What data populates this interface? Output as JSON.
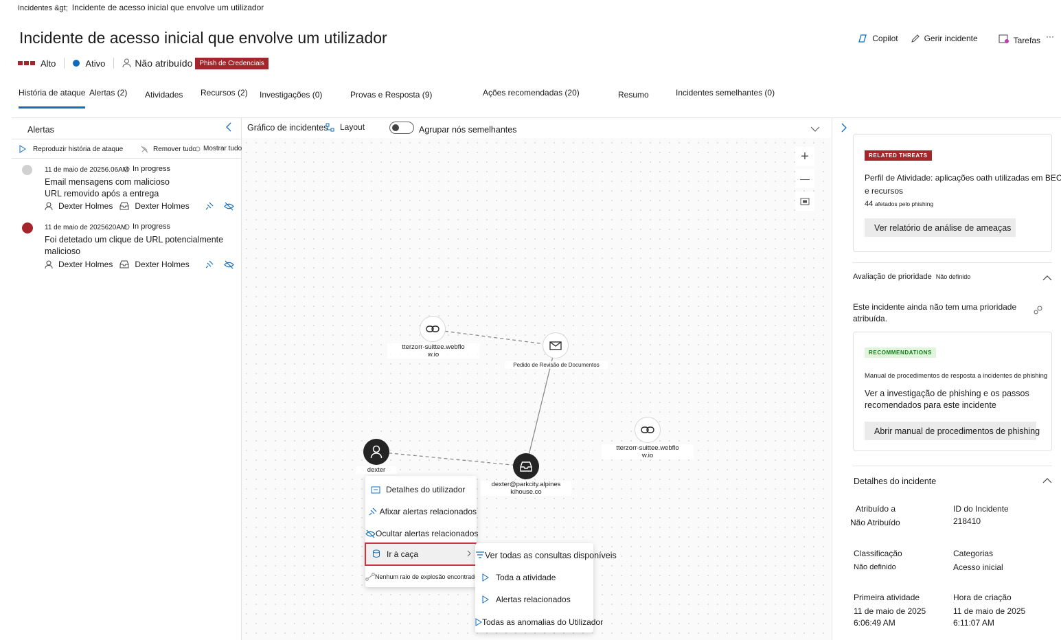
{
  "breadcrumb": {
    "root": "Incidentes &gt;",
    "current": "Incidente de acesso inicial que envolve um utilizador"
  },
  "page": {
    "title": "Incidente de acesso inicial que envolve um utilizador",
    "severity": "Alto",
    "status": "Ativo",
    "assignee": "Não atribuído",
    "tag": "Phish de Credenciais",
    "colors": {
      "severity": "#a4262c",
      "status": "#0f6cbd",
      "accent": "#0f6cbd"
    }
  },
  "actions": {
    "copilot": "Copilot",
    "manage": "Gerir incidente",
    "tasks": "Tarefas",
    "more": "···"
  },
  "tabs": [
    "História de ataque",
    "Alertas (2)",
    "Atividades",
    "Recursos (2)",
    "Investigações (0)",
    "Provas e Resposta (9)",
    "Ações recomendadas (20)",
    "Resumo",
    "Incidentes semelhantes (0)"
  ],
  "left_panel": {
    "title": "Alertas",
    "replay": "Reproduzir história de ataque",
    "remove_all": "Remover tudo",
    "show_all": "Mostrar tudo",
    "alerts": [
      {
        "date": "11 de maio de 20256.06AM",
        "status": "In progress",
        "title_line1": "Email mensagens com malicioso",
        "title_line2": "URL removido após a entrega",
        "user": "Dexter Holmes",
        "mailbox": "Dexter Holmes",
        "dot_color": "#d1d1d1"
      },
      {
        "date": "11 de maio de 2025620AM",
        "status": "In progress",
        "title_line1": "Foi detetado um clique de URL potencialmente",
        "title_line2": "malicioso",
        "user": "Dexter Holmes",
        "mailbox": "Dexter Holmes",
        "dot_color": "#a4262c"
      }
    ]
  },
  "graph": {
    "title": "Gráfico de incidentes",
    "layout": "Layout",
    "group_toggle": "Agrupar nós semelhantes",
    "zoom_in": "+",
    "zoom_out": "—",
    "nodes": {
      "url1_line1": "tterzorr-suittee.webflo",
      "url1_line2": "w.io",
      "email": "Pedido de Revisão de Documentos",
      "url2_line1": "tterzorr-suittee.webflo",
      "url2_line2": "w.io",
      "user": "dexter",
      "mailbox_line1": "dexter@parkcity.alpines",
      "mailbox_line2": "kihouse.co"
    },
    "context_menu": {
      "user_details": "Detalhes do utilizador",
      "pin_alerts": "Afixar alertas relacionados",
      "hide_alerts": "Ocultar alertas relacionados",
      "go_hunt": "Ir à caça",
      "blast_radius": "Nenhum raio de explosão encontrado"
    },
    "submenu": {
      "all_queries": "Ver todas as consultas disponíveis",
      "all_activity": "Toda a atividade",
      "related_alerts": "Alertas relacionados",
      "user_anomalies": "Todas as anomalias do Utilizador"
    }
  },
  "right_panel": {
    "threat_badge": "RELATED THREATS",
    "threat_title_line1": "Perfil de Atividade: aplicações oath utilizadas em BEC",
    "threat_title_line2": "e recursos",
    "threat_count": "44",
    "threat_count_label": "afetados pelo phishing",
    "threat_button": "Ver relatório de análise de ameaças",
    "priority_title": "Avaliação de prioridade",
    "priority_value": "Não definido",
    "priority_text_line1": "Este incidente ainda não tem uma prioridade",
    "priority_text_line2": "atribuída.",
    "rec_badge": "RECOMMENDATIONS",
    "rec_subtitle": "Manual de procedimentos de resposta a incidentes de phishing",
    "rec_text_line1": "Ver a investigação de phishing e os passos",
    "rec_text_line2": "recomendados para este incidente",
    "rec_button": "Abrir manual de procedimentos de phishing",
    "details_title": "Detalhes do incidente",
    "fields": {
      "assigned_label": "Atribuído a",
      "assigned_value": "Não Atribuído",
      "id_label": "ID do Incidente",
      "id_value": "218410",
      "class_label": "Classificação",
      "class_value": "Não definido",
      "cat_label": "Categorias",
      "cat_value": "Acesso inicial",
      "first_label": "Primeira atividade",
      "first_date": "11 de maio de 2025",
      "first_time": "6:06:49 AM",
      "created_label": "Hora de criação",
      "created_date": "11 de maio de 2025",
      "created_time": "6:11:07 AM"
    }
  }
}
